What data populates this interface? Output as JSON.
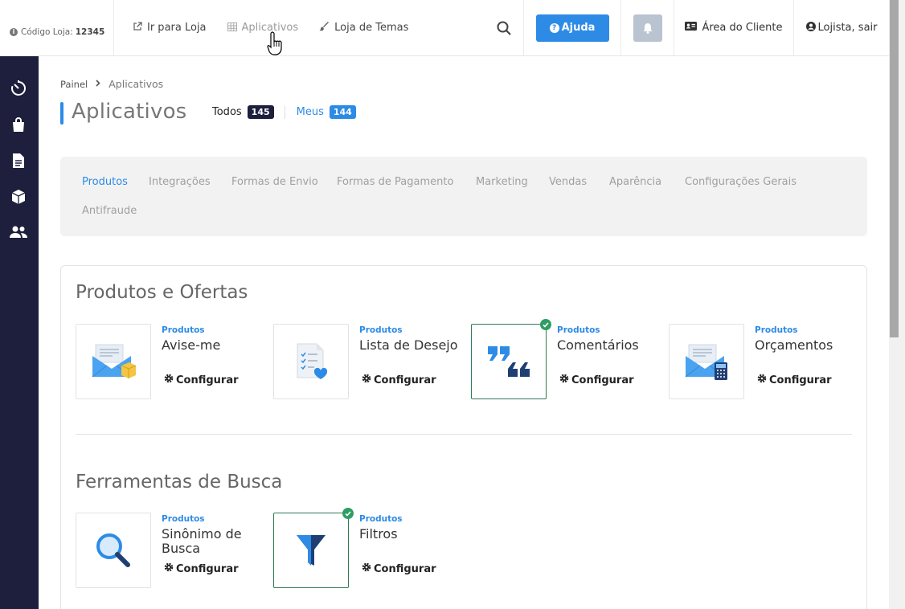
{
  "topbar": {
    "store_code_label": "Código Loja:",
    "store_code_value": "12345",
    "nav": [
      {
        "label": "Ir para Loja",
        "icon": "external-link-icon"
      },
      {
        "label": "Aplicativos",
        "icon": "grid-icon"
      },
      {
        "label": "Loja de Temas",
        "icon": "brush-icon"
      }
    ],
    "help_label": "Ajuda",
    "client_area_label": "Área do Cliente",
    "logout_label": "Lojista, sair"
  },
  "breadcrumb": {
    "home": "Painel",
    "current": "Aplicativos"
  },
  "page": {
    "title": "Aplicativos",
    "tab_all": "Todos",
    "tab_all_count": "145",
    "tab_mine": "Meus",
    "tab_mine_count": "144"
  },
  "categories": [
    "Produtos",
    "Integrações",
    "Formas de Envio",
    "Formas de Pagamento",
    "Marketing",
    "Vendas",
    "Aparência",
    "Configurações Gerais",
    "Antifraude"
  ],
  "sections": [
    {
      "title": "Produtos e Ofertas",
      "apps": [
        {
          "category": "Produtos",
          "name": "Avise-me",
          "action": "Configurar",
          "installed": false,
          "icon": "envelope-box-icon"
        },
        {
          "category": "Produtos",
          "name": "Lista de Desejo",
          "action": "Configurar",
          "installed": false,
          "icon": "checklist-heart-icon"
        },
        {
          "category": "Produtos",
          "name": "Comentários",
          "action": "Configurar",
          "installed": true,
          "icon": "quotes-icon"
        },
        {
          "category": "Produtos",
          "name": "Orçamentos",
          "action": "Configurar",
          "installed": false,
          "icon": "envelope-calculator-icon"
        }
      ]
    },
    {
      "title": "Ferramentas de Busca",
      "apps": [
        {
          "category": "Produtos",
          "name": "Sinônimo de Busca",
          "action": "Configurar",
          "installed": false,
          "icon": "magnifier-icon"
        },
        {
          "category": "Produtos",
          "name": "Filtros",
          "action": "Configurar",
          "installed": true,
          "icon": "funnel-icon"
        }
      ]
    }
  ],
  "colors": {
    "accent": "#2d8be6",
    "sidebar": "#1d1f3d",
    "installed_border": "#2e7a55",
    "installed_check": "#2e9e63"
  }
}
